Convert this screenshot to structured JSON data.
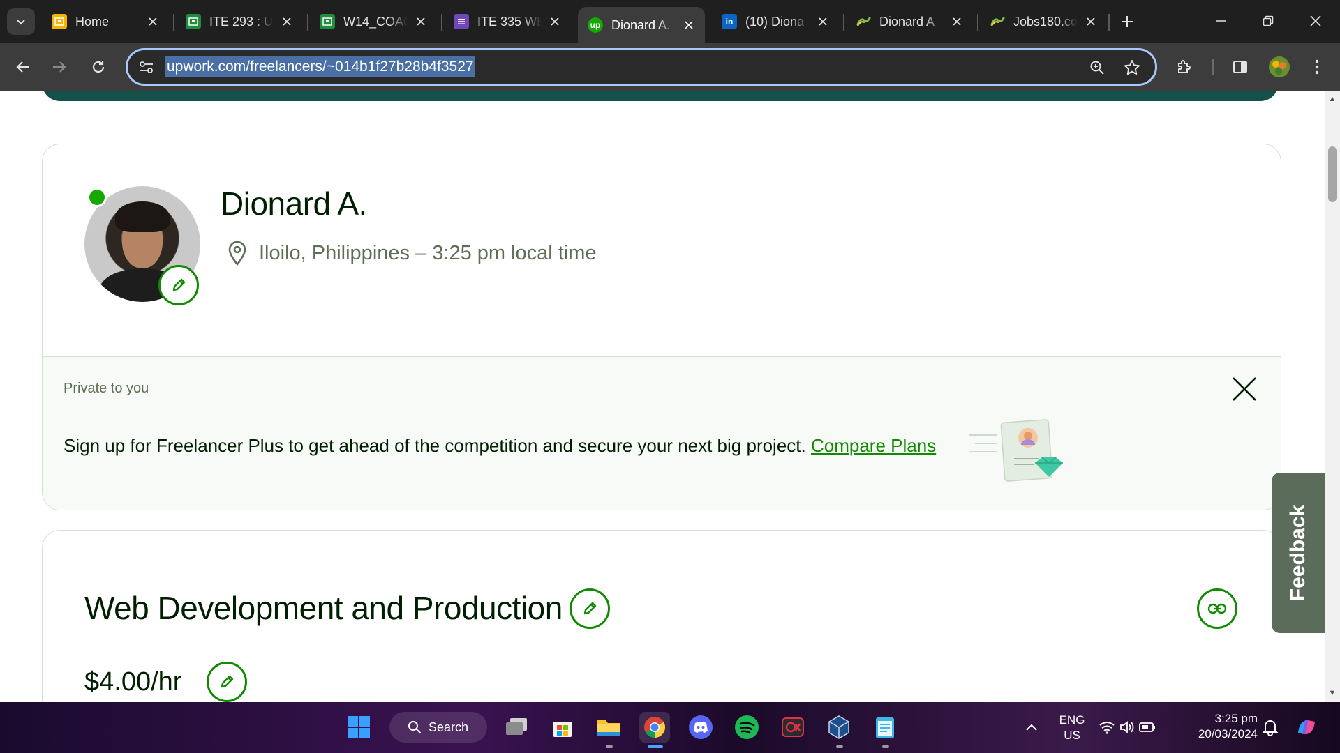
{
  "tabs": [
    {
      "title": "Home",
      "favicon": "google-classroom-icon",
      "color": "#f4b400",
      "active": false
    },
    {
      "title": "ITE 293 : U",
      "favicon": "google-classroom-icon",
      "color": "#1e8e3e",
      "active": false
    },
    {
      "title": "W14_COAC",
      "favicon": "google-classroom-icon",
      "color": "#1e8e3e",
      "active": false
    },
    {
      "title": "ITE 335 WE",
      "favicon": "google-forms-icon",
      "color": "#7248b9",
      "active": false
    },
    {
      "title": "Dionard A.",
      "favicon": "upwork-icon",
      "color": "#14a800",
      "active": true
    },
    {
      "title": "(10) Diona",
      "favicon": "linkedin-icon",
      "color": "#0a66c2",
      "active": false
    },
    {
      "title": "Dionard A",
      "favicon": "jobs-link-icon",
      "color": "#7bc043",
      "active": false
    },
    {
      "title": "Jobs180.co",
      "favicon": "jobs-link-icon",
      "color": "#7bc043",
      "active": false
    }
  ],
  "address_bar": {
    "url": "upwork.com/freelancers/~014b1f27b28b4f3527"
  },
  "profile": {
    "name": "Dionard A.",
    "location": "Iloilo, Philippines – 3:25 pm local time",
    "online_status_color": "#14a800"
  },
  "private_notice": {
    "label": "Private to you",
    "message": "Sign up for Freelancer Plus to get ahead of the competition and secure your next big project.",
    "link_text": "Compare Plans"
  },
  "feedback": {
    "label": "Feedback"
  },
  "service": {
    "title": "Web Development and Production",
    "rate": "$4.00/hr"
  },
  "taskbar": {
    "search_label": "Search",
    "language": "ENG",
    "region": "US",
    "time": "3:25 pm",
    "date": "20/03/2024"
  },
  "colors": {
    "brand_green": "#108a00",
    "banner_teal": "#14514a",
    "feedback_bg": "#5b6c5a"
  }
}
